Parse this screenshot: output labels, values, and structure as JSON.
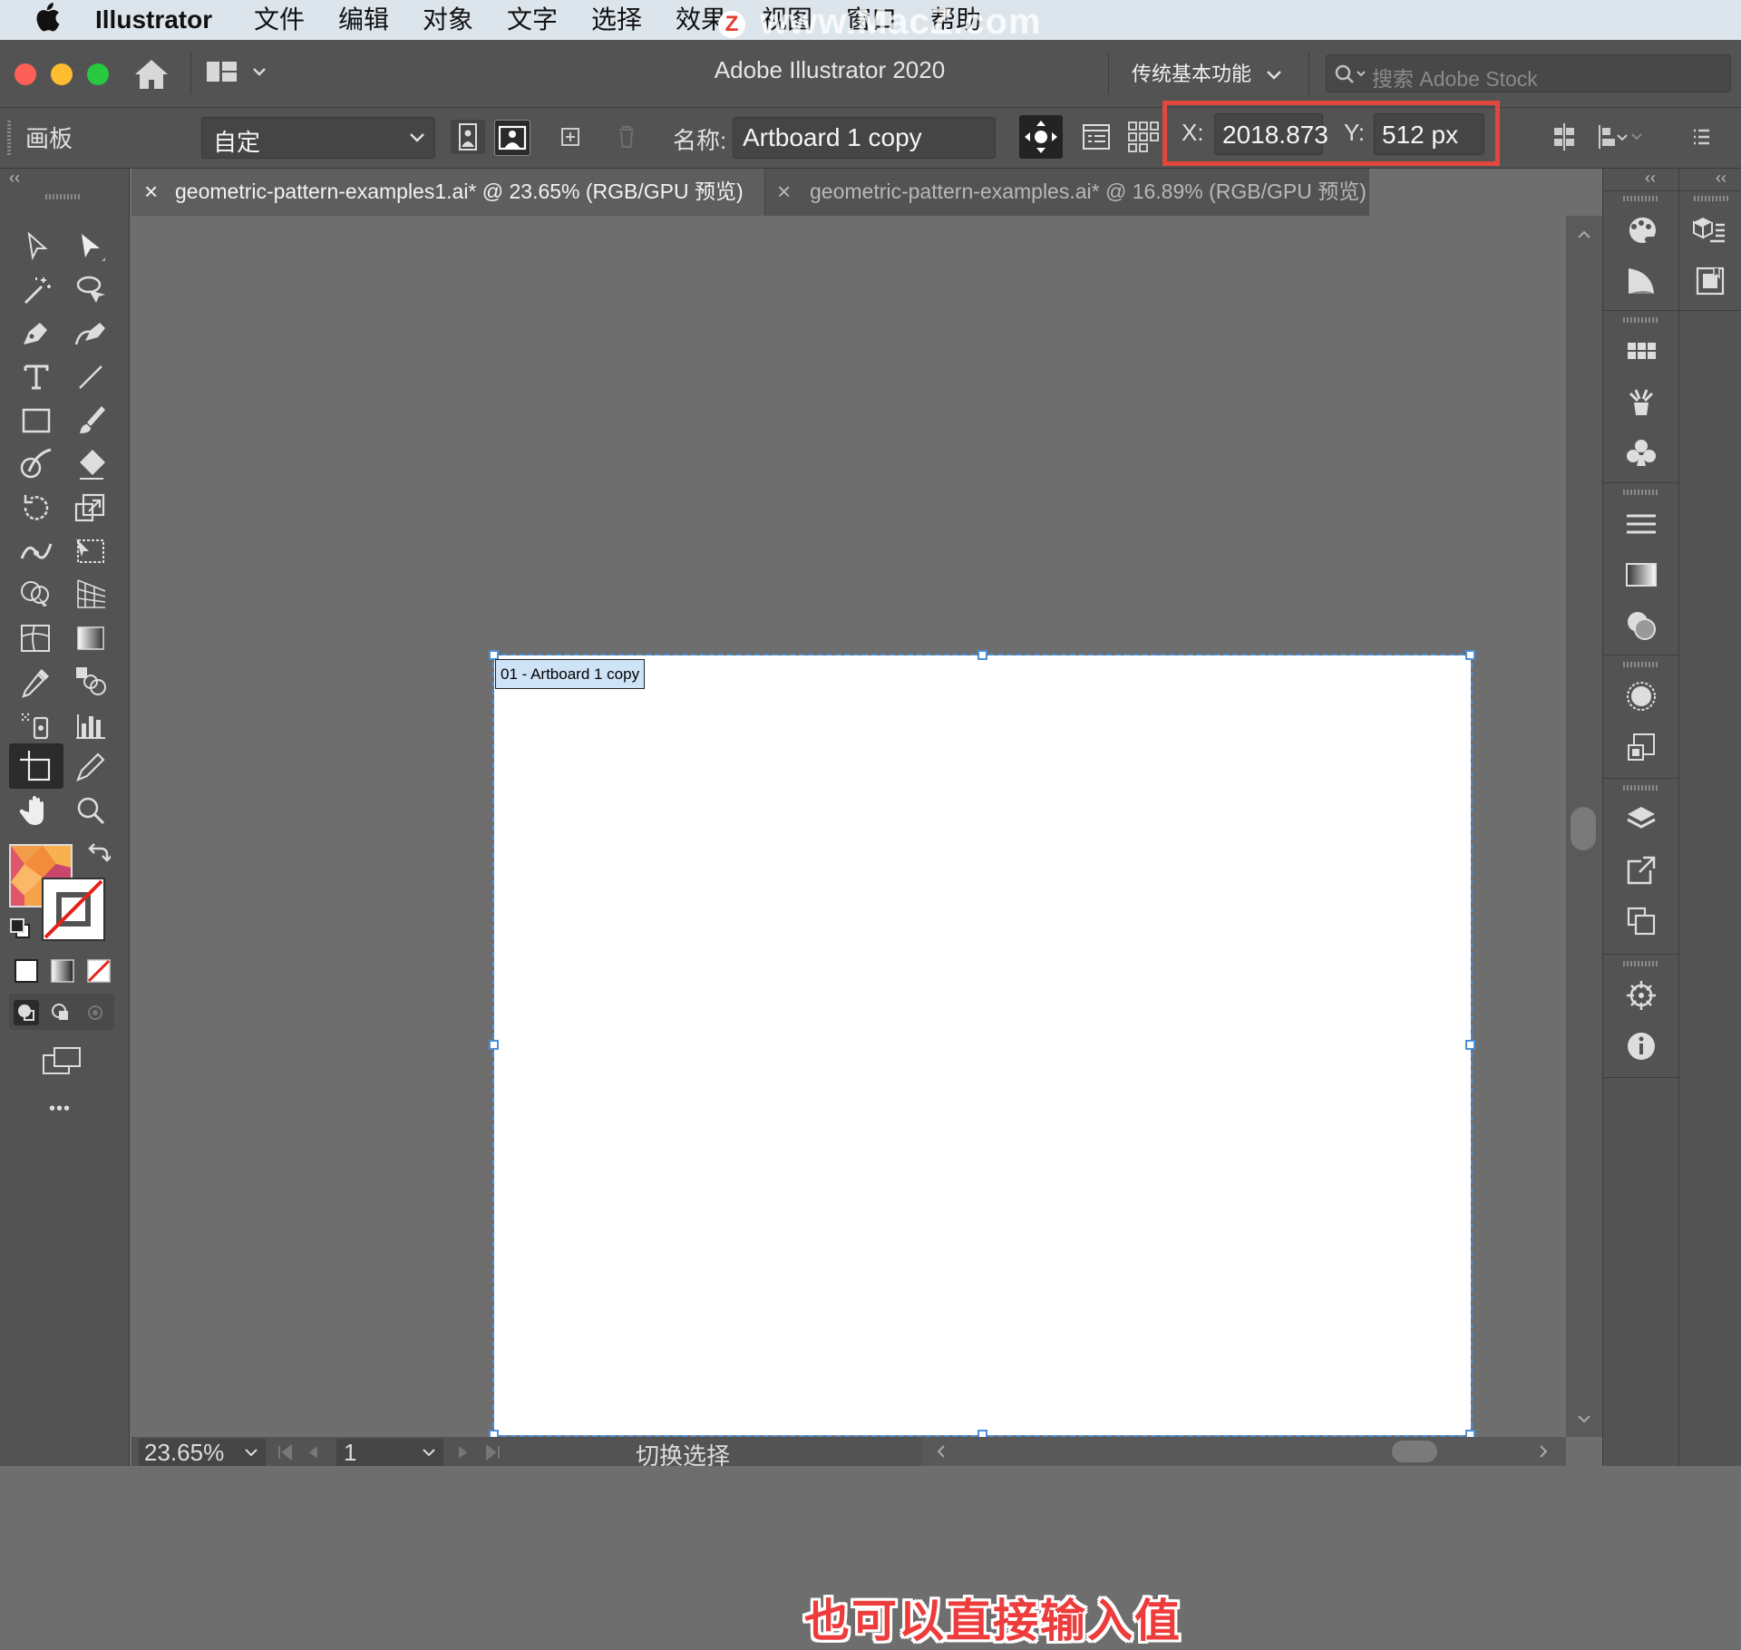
{
  "menubar": {
    "app_name": "Illustrator",
    "items": [
      "文件",
      "编辑",
      "对象",
      "文字",
      "选择",
      "效果",
      "视图",
      "窗口",
      "帮助"
    ],
    "watermark": "www.MacZ.com",
    "watermark_badge": "Z"
  },
  "titlebar": {
    "title": "Adobe Illustrator 2020",
    "workspace": "传统基本功能",
    "search_placeholder": "搜索 Adobe Stock"
  },
  "controlbar": {
    "panel_label": "画板",
    "preset_value": "自定",
    "name_label": "名称:",
    "name_value": "Artboard 1 copy",
    "x_label": "X:",
    "x_value": "2018.873",
    "y_label": "Y:",
    "y_value": "512 px"
  },
  "tabs": [
    {
      "close": "×",
      "label": "geometric-pattern-examples1.ai* @ 23.65% (RGB/GPU 预览)"
    },
    {
      "close": "×",
      "label": "geometric-pattern-examples.ai* @ 16.89% (RGB/GPU 预览)"
    }
  ],
  "canvas": {
    "artboard_label": "01 - Artboard 1 copy",
    "subtitle": "也可以直接输入值"
  },
  "statusbar": {
    "zoom": "23.65%",
    "artboard_number": "1",
    "mode": "切换选择"
  },
  "panel_collapse": "‹‹",
  "toolbar_more": "•••",
  "colors": {
    "accent_highlight": "#e0483e",
    "selection_blue": "#4a90d9",
    "panel_bg": "#535353",
    "canvas_bg": "#6e6e6e"
  }
}
